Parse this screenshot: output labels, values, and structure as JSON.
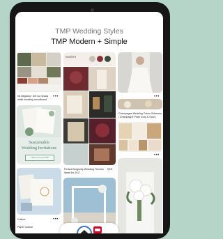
{
  "header": {
    "board_title": "TMP Wedding Styles",
    "section_title": "TMP Modern + Simple"
  },
  "pins": {
    "col1_caption1": "rst elegance: Get our shady",
    "col1_caption2": "white wedding moodboard",
    "col1_sust_line1": "Sustainable",
    "col1_sust_line2": "Wedding Invitations",
    "col1_button": "Learn more at TMP",
    "col1_caption3": "Culture",
    "col1_caption4": "Paper Culture",
    "col2_banner": "modern",
    "col2_caption1": "Perfect Burgundy Wedding Themes",
    "col2_caption2": "Ideas for 2017 ...",
    "col3_caption1": "Champagne Wedding Colors Schemes",
    "col3_caption2": "| Champagne Pearl Ivory & Gold |"
  },
  "colors": {
    "accent": "#3a73c8",
    "background": "#b5d5c8",
    "brand_red": "#e60023"
  },
  "nav": {
    "active": "home",
    "icons": [
      "home-icon",
      "search-icon",
      "notifications-icon"
    ]
  }
}
